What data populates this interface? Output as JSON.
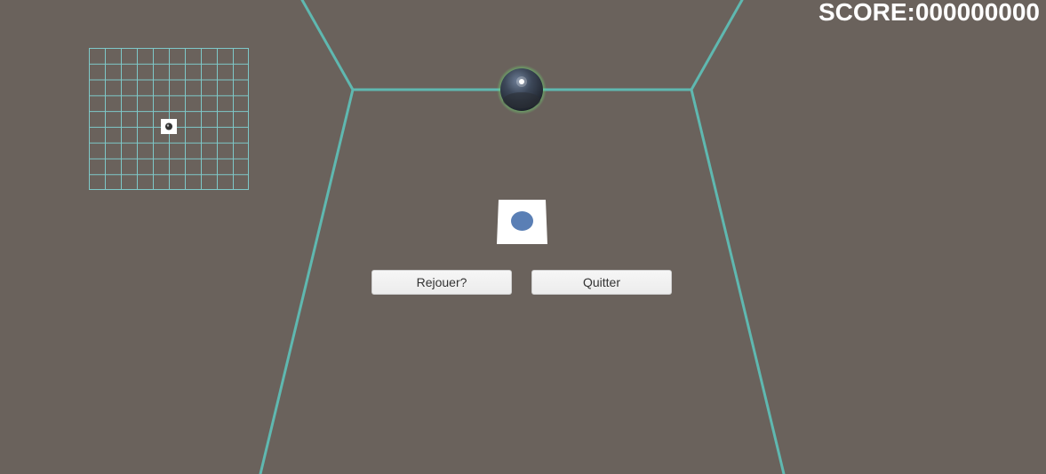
{
  "hud": {
    "score_text": "SCORE:000000000"
  },
  "menu": {
    "replay_label": "Rejouer?",
    "quit_label": "Quitter"
  },
  "colors": {
    "background": "#6a625c",
    "wall_edge": "#5fb8b0",
    "grid_line": "#7ec8c8",
    "ball_glow": "#6fd36f",
    "target_dot": "#5a7fb5"
  },
  "icons": {
    "player": "sphere-ball-icon",
    "target": "blue-circle-target-icon",
    "minimap_marker": "player-marker-icon"
  }
}
